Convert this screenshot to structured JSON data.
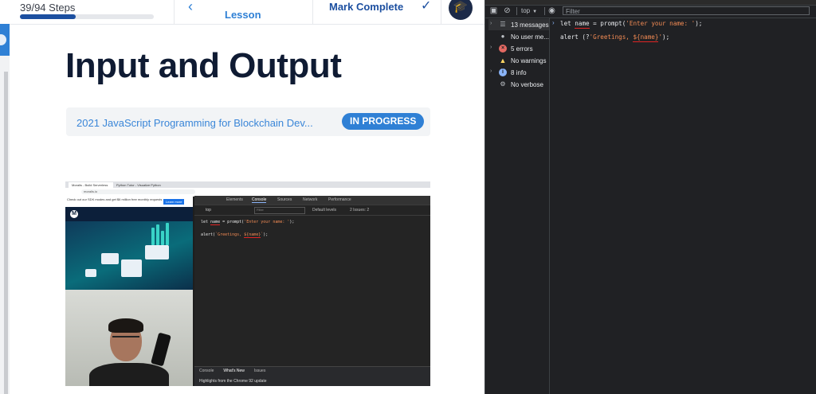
{
  "lesson_header": {
    "steps_text": "39/94 Steps",
    "progress_fraction": 0.415,
    "previous_label": "Lesson",
    "mark_complete_label": "Mark Complete"
  },
  "lesson": {
    "title": "Input and Output",
    "course_name": "2021 JavaScript Programming for Blockchain Dev...",
    "status_badge": "IN PROGRESS"
  },
  "video": {
    "tabs": [
      "Moralis - Build Serverless Web3",
      "Python Tutor - Visualize Python"
    ],
    "url": "moralis.io",
    "banner_text": "Check out our SDK modes and get $6 million free monthly requests",
    "banner_button": "Learn more",
    "devtools_tabs": [
      "Elements",
      "Console",
      "Sources",
      "Network",
      "Performance"
    ],
    "context": "top",
    "filter_placeholder": "Filter",
    "levels": "Default levels",
    "issues": "2 Issues:",
    "issues_count": "2",
    "code_line1_a": "let ",
    "code_line1_name": "name",
    "code_line1_b": " = prompt(",
    "code_line1_str": "'Enter your name: '",
    "code_line1_c": ");",
    "code_line2_a": "alert(",
    "code_line2_str": "`Greetings, ",
    "code_line2_name": "${name}",
    "code_line2_end": "`",
    "code_line2_c": ");",
    "drawer_tabs": [
      "Console",
      "What's New",
      "Issues"
    ],
    "drawer_note": "Highlights from the Chrome 92 update"
  },
  "devtools": {
    "context": "top",
    "filter_placeholder": "Filter",
    "sidebar": [
      {
        "label": "13 messages",
        "icon": "list-icon",
        "selected": true
      },
      {
        "label": "No user me...",
        "icon": "user-icon",
        "selected": false
      },
      {
        "label": "5 errors",
        "icon": "error-icon",
        "selected": false
      },
      {
        "label": "No warnings",
        "icon": "warning-icon",
        "selected": false
      },
      {
        "label": "8 info",
        "icon": "info-icon",
        "selected": false
      },
      {
        "label": "No verbose",
        "icon": "verbose-icon",
        "selected": false
      }
    ],
    "code": {
      "line1_a": "let ",
      "line1_name": "name",
      "line1_b": " = prompt(",
      "line1_str": "'Enter your name: '",
      "line1_c": ");",
      "line2_a": "alert (?",
      "line2_str": "'Greetings, ",
      "line2_name": "${name}",
      "line2_end": "'",
      "line2_c": ");"
    }
  },
  "colors": {
    "accent_blue": "#2f80d5",
    "title_navy": "#0f1b33",
    "devtools_bg": "#202124",
    "error_red": "#e46962",
    "string_orange": "#f28b54"
  }
}
